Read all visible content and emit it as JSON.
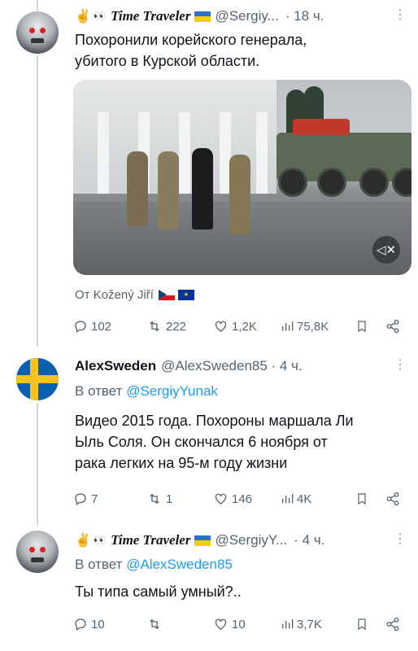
{
  "tweet1": {
    "display_name": "Time Traveler",
    "handle": "@Sergiy...",
    "time": "· 18 ч.",
    "text_line1": "Похоронили корейского генерала,",
    "text_line2": "убитого в Курской области.",
    "from_label": "От Kožený Jiří",
    "actions": {
      "replies": "102",
      "reposts": "222",
      "likes": "1,2K",
      "views": "75,8K"
    }
  },
  "tweet2": {
    "display_name": "AlexSweden",
    "handle": "@AlexSweden85 · 4 ч.",
    "reply_prefix": "В ответ",
    "reply_to": "@SergiyYunak",
    "text_line1": "Видео 2015 года. Похороны маршала Ли",
    "text_line2": "Ыль Соля. Он скончался 6 ноября от",
    "text_line3": "рака легких на 95-м году жизни",
    "actions": {
      "replies": "7",
      "reposts": "1",
      "likes": "146",
      "views": "4K"
    }
  },
  "tweet3": {
    "display_name": "Time Traveler",
    "handle": "@SergiyY...",
    "time": "· 4 ч.",
    "reply_prefix": "В ответ",
    "reply_to": "@AlexSweden85",
    "text_line1": "Ты типа самый умный?..",
    "actions": {
      "replies": "10",
      "reposts": "",
      "likes": "10",
      "views": "3,7K"
    }
  },
  "icons": {
    "reply": "reply-icon",
    "repost": "repost-icon",
    "like": "heart-icon",
    "views": "views-icon",
    "bookmark": "bookmark-icon",
    "share": "share-icon",
    "mute": "mute-icon",
    "more": "more-icon"
  },
  "colors": {
    "link": "#1d9bf0",
    "secondary": "#536471",
    "text": "#0f1419"
  }
}
